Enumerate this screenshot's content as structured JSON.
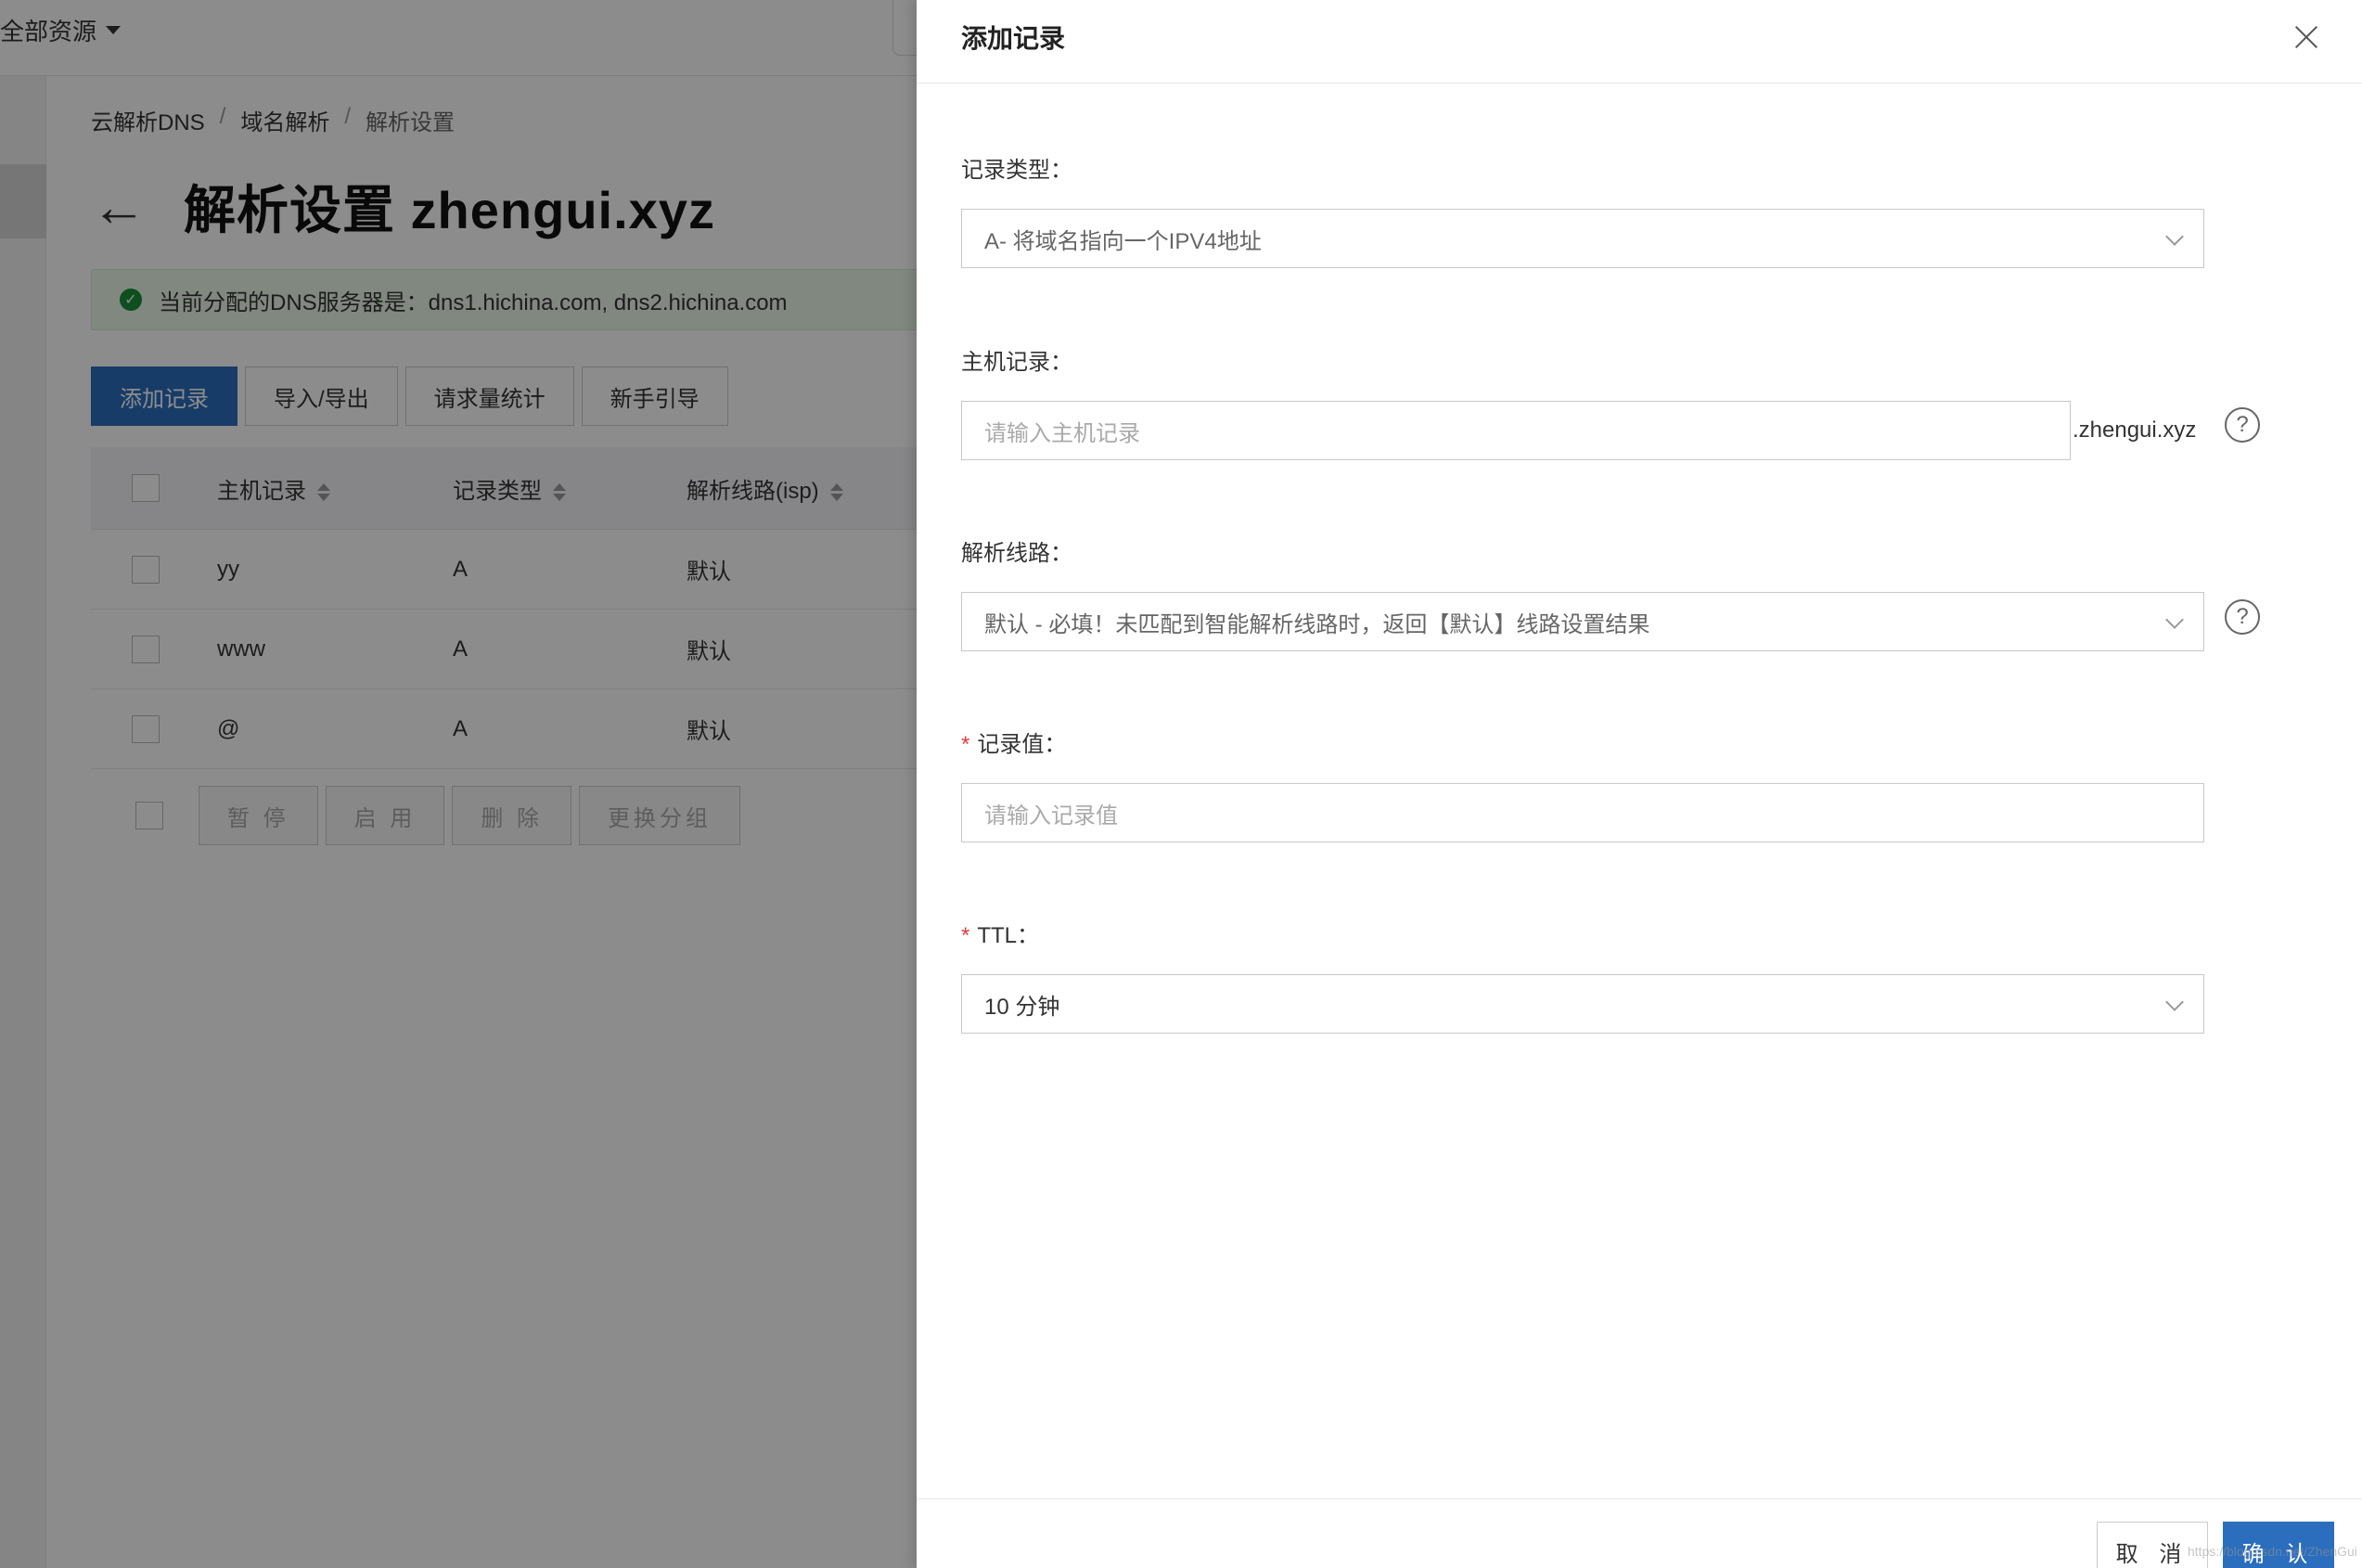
{
  "topbar": {
    "resources_label": "全部资源"
  },
  "breadcrumb": {
    "item1": "云解析DNS",
    "item2": "域名解析",
    "item3": "解析设置",
    "sep": "/"
  },
  "page": {
    "title": "解析设置 zhengui.xyz",
    "notice": "当前分配的DNS服务器是：dns1.hichina.com, dns2.hichina.com"
  },
  "actions": {
    "add_record": "添加记录",
    "import_export": "导入/导出",
    "request_stats": "请求量统计",
    "guide": "新手引导"
  },
  "table": {
    "headers": {
      "host": "主机记录",
      "type": "记录类型",
      "line": "解析线路(isp)"
    },
    "rows": [
      {
        "host": "yy",
        "type": "A",
        "line": "默认"
      },
      {
        "host": "www",
        "type": "A",
        "line": "默认"
      },
      {
        "host": "@",
        "type": "A",
        "line": "默认"
      }
    ]
  },
  "bulk": {
    "pause": "暂 停",
    "enable": "启 用",
    "delete": "删 除",
    "change_group": "更换分组"
  },
  "drawer": {
    "title": "添加记录",
    "record_type": {
      "label": "记录类型：",
      "value": "A- 将域名指向一个IPV4地址"
    },
    "host": {
      "label": "主机记录：",
      "placeholder": "请输入主机记录",
      "suffix": ".zhengui.xyz"
    },
    "line": {
      "label": "解析线路：",
      "value": "默认 - 必填！未匹配到智能解析线路时，返回【默认】线路设置结果"
    },
    "record_value": {
      "required": "*",
      "label": "记录值：",
      "placeholder": "请输入记录值"
    },
    "ttl": {
      "required": "*",
      "label": "TTL：",
      "value": "10 分钟"
    },
    "help_glyph": "?",
    "cancel": "取 消",
    "confirm": "确 认",
    "watermark": "https://blog.csdn.net/ZhenGui"
  }
}
